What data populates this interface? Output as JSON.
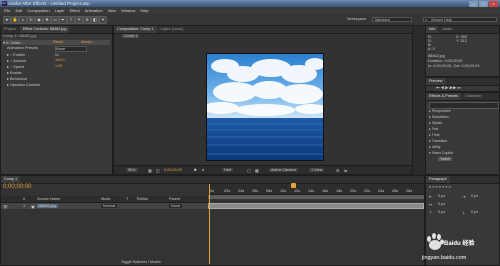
{
  "app": {
    "title": "Adobe After Effects - Untitled Project.aep",
    "logo": "Ae"
  },
  "menu": [
    "File",
    "Edit",
    "Composition",
    "Layer",
    "Effect",
    "Animation",
    "View",
    "Window",
    "Help"
  ],
  "toolbar": {
    "workspace_label": "Workspace:",
    "workspace_value": "Standard",
    "search_placeholder": "Search Help"
  },
  "left_panel": {
    "tabs": [
      "Project",
      "Effect Controls: 88462.jpg"
    ],
    "header": "Comp 1 • 88462.jpg",
    "effect_name": "Twitch",
    "reset_label": "Reset",
    "about_label": "About...",
    "props": [
      {
        "name": "Animation Presets",
        "value": "None"
      },
      {
        "name": "Enable",
        "value": ""
      },
      {
        "name": "Amount",
        "value": "100.0"
      },
      {
        "name": "Speed",
        "value": "1.00"
      },
      {
        "name": "Enable",
        "value": ""
      },
      {
        "name": "Behaviour",
        "value": ""
      },
      {
        "name": "Operator Controls",
        "value": ""
      }
    ]
  },
  "comp_panel": {
    "tabs": [
      "Composition: Comp 1",
      "Layer: (none)"
    ],
    "comp_label": "Comp 1",
    "zoom": "50%",
    "timecode": "0;00;00;00",
    "resolution": "Half",
    "camera": "Active Camera",
    "view": "1 View"
  },
  "right_panel": {
    "info_tabs": [
      "Info",
      "Audio"
    ],
    "info_lines": [
      "R:",
      "G:",
      "B:",
      "A: 0",
      "X: 392",
      "Y: 312",
      "88462.jpg",
      "Duration: 0;00;30;00",
      "In: 0;00;00;00, Out: 0;00;29;29"
    ],
    "preview_tab": "Preview",
    "effects_tabs": [
      "Effects & Presets",
      "Character"
    ],
    "search_value": "",
    "fx_categories": [
      "Perspective",
      "Simulation",
      "Stylize",
      "Text",
      "Time",
      "Transition",
      "Utility",
      "Video Copilot"
    ],
    "fx_selected": "Twitch",
    "paragraph_tab": "Paragraph",
    "para_values": [
      "0 px",
      "0 px",
      "0 px",
      "0 px",
      "0 px"
    ]
  },
  "timeline": {
    "tab": "Comp 1",
    "timecode": "0;00;00;00",
    "columns": [
      "#",
      "Source Name",
      "Mode",
      "T",
      "TrkMat",
      "Parent"
    ],
    "layer": {
      "num": "1",
      "name": "88462.jpg",
      "mode": "Normal",
      "parent": "None"
    },
    "ruler": [
      "0s",
      "02s",
      "04s",
      "06s",
      "08s",
      "10s",
      "12s",
      "14s",
      "16s",
      "18s",
      "20s",
      "22s",
      "24s",
      "26s",
      "28s"
    ],
    "bottom_label": "Toggle Switches / Modes"
  },
  "watermark": {
    "brand": "Baidu 经验",
    "url": "jingyan.baidu.com"
  }
}
